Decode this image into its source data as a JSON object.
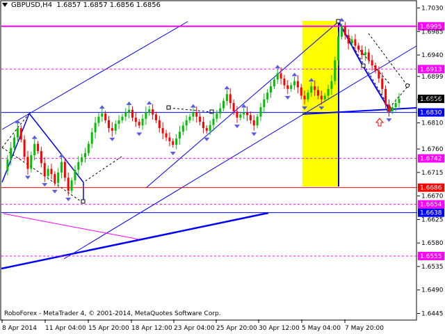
{
  "chart_data": {
    "type": "candlestick",
    "title": "GBPUSD,H4  1.6857 1.6857 1.6856 1.6856",
    "symbol": "GBPUSD",
    "timeframe": "H4",
    "ohlc": {
      "open": 1.6857,
      "high": 1.6857,
      "low": 1.6856,
      "close": 1.6856
    },
    "footer": "RoboForex - MetaTrader 4, © 2001-2014, MetaQuotes Software Corp.",
    "ylim": [
      1.6435,
      1.704
    ],
    "y_ticks": [
      "1.7030",
      "1.6985",
      "1.6940",
      "1.6899",
      "1.6855",
      "1.6810",
      "1.6760",
      "1.6715",
      "1.6670",
      "1.6625",
      "1.6580",
      "1.6535",
      "1.6490",
      "1.6445"
    ],
    "x_ticks": [
      "8 Apr 2014",
      "11 Apr 04:00",
      "15 Apr 20:00",
      "18 Apr 12:00",
      "23 Apr 04:00",
      "25 Apr 20:00",
      "30 Apr 12:00",
      "5 May 04:00",
      "7 May 20:00"
    ],
    "levels": [
      {
        "value": 1.6995,
        "label": "1.6995",
        "color": "#ff00ff",
        "style": "solid"
      },
      {
        "value": 1.6913,
        "label": "1.6913",
        "color": "#ff00ff",
        "style": "dashed"
      },
      {
        "value": 1.6856,
        "label": "1.6856",
        "color": "#000000",
        "style": "price"
      },
      {
        "value": 1.683,
        "label": "1.6830",
        "color": "#0000ff",
        "style": "solid"
      },
      {
        "value": 1.6742,
        "label": "1.6742",
        "color": "#ff00ff",
        "style": "dashed"
      },
      {
        "value": 1.6686,
        "label": "1.6686",
        "color": "#ff0000",
        "style": "solid"
      },
      {
        "value": 1.6654,
        "label": "1.6654",
        "color": "#ff00ff",
        "style": "dashed"
      },
      {
        "value": 1.6638,
        "label": "1.6638",
        "color": "#0000ff",
        "style": "solid"
      },
      {
        "value": 1.6555,
        "label": "1.6555",
        "color": "#ff00ff",
        "style": "dashed"
      }
    ],
    "colors": {
      "bull": "#00c000",
      "bear": "#ff0000",
      "grid_text": "#000000",
      "highlight": "#ffff00",
      "trend": "#0000ff",
      "level": "#ff00ff"
    },
    "price_series": [
      1.6718,
      1.674,
      1.6762,
      1.6782,
      1.68,
      1.6778,
      1.6745,
      1.6722,
      1.6748,
      1.677,
      1.6756,
      1.6733,
      1.6708,
      1.6722,
      1.6712,
      1.6695,
      1.6715,
      1.6735,
      1.6705,
      1.668,
      1.67,
      1.672,
      1.6735,
      1.6744,
      1.6752,
      1.677,
      1.6792,
      1.681,
      1.6822,
      1.6828,
      1.6815,
      1.68,
      1.6795,
      1.6808,
      1.6815,
      1.6822,
      1.683,
      1.6835,
      1.682,
      1.6812,
      1.6805,
      1.6818,
      1.683,
      1.6836,
      1.6826,
      1.6815,
      1.68,
      1.679,
      1.6782,
      1.6775,
      1.6768,
      1.678,
      1.6793,
      1.6805,
      1.6815,
      1.6822,
      1.683,
      1.6822,
      1.6812,
      1.68,
      1.6795,
      1.6806,
      1.6818,
      1.6828,
      1.6838,
      1.6852,
      1.6865,
      1.6848,
      1.6832,
      1.682,
      1.6826,
      1.683,
      1.6825,
      1.6815,
      1.6805,
      1.6822,
      1.684,
      1.6855,
      1.6868,
      1.688,
      1.6893,
      1.6905,
      1.6895,
      1.6882,
      1.6875,
      1.6882,
      1.689,
      1.6878,
      1.6862,
      1.6855,
      1.6868,
      1.688,
      1.6873,
      1.6862,
      1.6855,
      1.6862,
      1.6875,
      1.689,
      1.693,
      1.6975,
      1.6995,
      1.6978,
      1.6962,
      1.697,
      1.6958,
      1.695,
      1.694,
      1.6945,
      1.693,
      1.692,
      1.691,
      1.6895,
      1.6875,
      1.6845,
      1.6832,
      1.684,
      1.6848,
      1.6856
    ]
  }
}
